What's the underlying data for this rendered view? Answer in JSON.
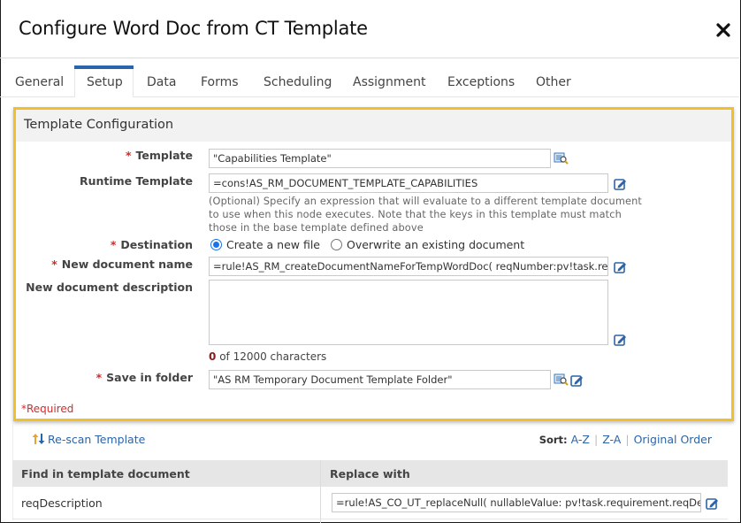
{
  "dialog": {
    "title": "Configure Word Doc from CT Template",
    "close_icon": "close-icon"
  },
  "tabs": [
    {
      "label": "General",
      "active": false
    },
    {
      "label": "Setup",
      "active": true
    },
    {
      "label": "Data",
      "active": false
    },
    {
      "label": "Forms",
      "active": false
    },
    {
      "label": "Scheduling",
      "active": false
    },
    {
      "label": "Assignment",
      "active": false
    },
    {
      "label": "Exceptions",
      "active": false
    },
    {
      "label": "Other",
      "active": false
    }
  ],
  "template_config": {
    "heading": "Template Configuration",
    "required_marker": "*",
    "fields": {
      "template": {
        "label": "Template",
        "value": "\"Capabilities Template\"",
        "required": true
      },
      "runtime_template": {
        "label": "Runtime Template",
        "value": "=cons!AS_RM_DOCUMENT_TEMPLATE_CAPABILITIES",
        "help": "(Optional) Specify an expression that will evaluate to a different template document to use when this node executes. Note that the keys in this template must match those in the base template defined above"
      },
      "destination": {
        "label": "Destination",
        "required": true,
        "options": [
          "Create a new file",
          "Overwrite an existing document"
        ],
        "selected": "Create a new file"
      },
      "new_document_name": {
        "label": "New document name",
        "required": true,
        "value": "=rule!AS_RM_createDocumentNameForTempWordDoc(  reqNumber:pv!task.requireme"
      },
      "new_document_description": {
        "label": "New document description",
        "value": "",
        "char_count": "0",
        "char_count_suffix": "of 12000 characters"
      },
      "save_in_folder": {
        "label": "Save in folder",
        "required": true,
        "value": "\"AS RM Temporary Document Template Folder\""
      }
    },
    "required_note": "*Required"
  },
  "rescan": {
    "label": "Re-scan Template"
  },
  "sort": {
    "label": "Sort:",
    "options": [
      "A-Z",
      "Z-A",
      "Original Order"
    ]
  },
  "mapping_table": {
    "columns": [
      "Find in template document",
      "Replace with"
    ],
    "rows": [
      {
        "find": "reqDescription",
        "replace": "=rule!AS_CO_UT_replaceNull(  nullableValue: pv!task.requirement.reqDescription"
      }
    ]
  },
  "colors": {
    "highlight_border": "#f1bf2a",
    "link": "#2b64a8",
    "required": "#d42a2a",
    "active_tab": "#2b64a8"
  }
}
